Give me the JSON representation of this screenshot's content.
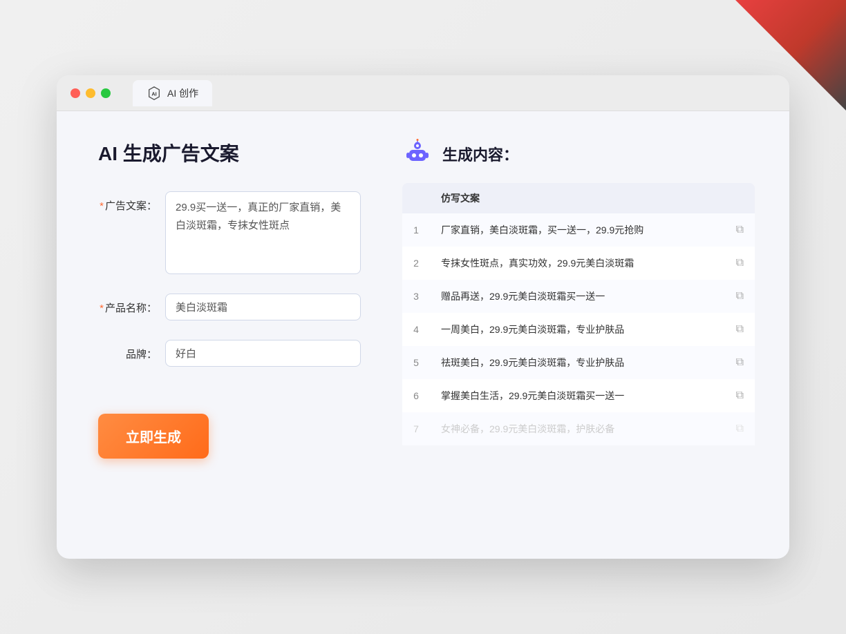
{
  "window": {
    "tab_title": "AI 创作"
  },
  "left": {
    "page_title": "AI 生成广告文案",
    "form": {
      "ad_copy_label": "广告文案：",
      "ad_copy_required": "*",
      "ad_copy_value": "29.9买一送一，真正的厂家直销，美白淡斑霜，专抹女性斑点",
      "product_name_label": "产品名称：",
      "product_name_required": "*",
      "product_name_value": "美白淡斑霜",
      "brand_label": "品牌：",
      "brand_value": "好白",
      "generate_button": "立即生成"
    }
  },
  "right": {
    "result_title": "生成内容：",
    "table": {
      "column_header": "仿写文案",
      "rows": [
        {
          "num": 1,
          "text": "厂家直销，美白淡斑霜，买一送一，29.9元抢购",
          "faded": false
        },
        {
          "num": 2,
          "text": "专抹女性斑点，真实功效，29.9元美白淡斑霜",
          "faded": false
        },
        {
          "num": 3,
          "text": "赠品再送，29.9元美白淡斑霜买一送一",
          "faded": false
        },
        {
          "num": 4,
          "text": "一周美白，29.9元美白淡斑霜，专业护肤品",
          "faded": false
        },
        {
          "num": 5,
          "text": "祛斑美白，29.9元美白淡斑霜，专业护肤品",
          "faded": false
        },
        {
          "num": 6,
          "text": "掌握美白生活，29.9元美白淡斑霜买一送一",
          "faded": false
        },
        {
          "num": 7,
          "text": "女神必备，29.9元美白淡斑霜，护肤必备",
          "faded": true
        }
      ]
    }
  }
}
